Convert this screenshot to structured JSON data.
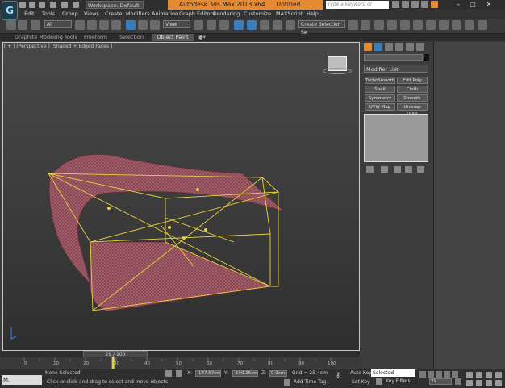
{
  "app": {
    "logo_text": "G",
    "title": "Autodesk 3ds Max  2013 x64",
    "document": "Untitled",
    "workspace": "Workspace: Default",
    "search_placeholder": "Type a keyword or phrase"
  },
  "menu": [
    "Edit",
    "Tools",
    "Group",
    "Views",
    "Create",
    "Modifiers",
    "Animation",
    "Graph Editors",
    "Rendering",
    "Customize",
    "MAXScript",
    "Help"
  ],
  "toolbar": {
    "selection_filter": "All",
    "coord_system": "View",
    "named_selection": "Create Selection Se"
  },
  "ribbon": {
    "tabs": [
      "Graphite Modeling Tools",
      "Freeform",
      "Selection",
      "Object Paint"
    ],
    "active_tab": "Object Paint"
  },
  "viewport": {
    "label": "[ + ] [Perspective ] [Shaded + Edged Faces ]"
  },
  "command_panel": {
    "modifier_list": "Modifier List",
    "modifier_buttons": [
      "TurboSmooth",
      "Edit Poly",
      "Shell",
      "Cloth",
      "Symmetry",
      "Smooth",
      "UVW Map",
      "Unwrap UVW"
    ]
  },
  "timeline": {
    "current": "29 / 100",
    "ticks": [
      "0",
      "10",
      "20",
      "30",
      "40",
      "50",
      "60",
      "70",
      "80",
      "90",
      "100"
    ],
    "current_fraction": 0.29
  },
  "status": {
    "taskbar_label": "M.",
    "selection": "None Selected",
    "prompt": "Click or click-and-drag to select and move objects",
    "x_label": "X:",
    "y_label": "Y:",
    "z_label": "Z:",
    "x_value": "-187.67cm",
    "y_value": "-100.35cm",
    "z_value": "0.0cm",
    "grid": "Grid = 25.4cm",
    "add_time_tag": "Add Time Tag",
    "auto_key": "Auto Key",
    "auto_key_value": "Selected",
    "set_key": "Set Key",
    "key_filters": "Key Filters...",
    "frame": "29"
  }
}
